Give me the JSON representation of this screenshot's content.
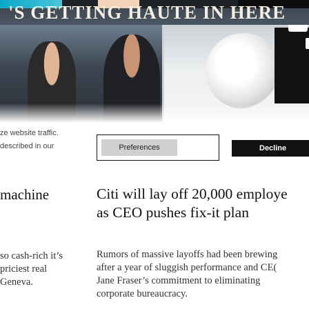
{
  "hero": {
    "headline": "'S GETTING HAUTE IN HERE"
  },
  "cookie_banner": {
    "text_line1": "ze website traffic.",
    "text_line2": "described in our",
    "preferences_label": "Preferences",
    "decline_label": "Decline"
  },
  "articles": {
    "left": {
      "title": "machine",
      "summary_lines": [
        "so cash-rich it’s",
        "priciest real",
        "Geneva."
      ]
    },
    "right": {
      "title_lines": [
        "Citi will lay off 20,000 employe",
        "as CEO pushes fix-it plan"
      ],
      "summary_lines": [
        "Rumors of massive layoffs had been brewing",
        "after a year of sluggish performance and CE(",
        "Jane Fraser’s commitment to eliminating",
        "corporate bureaucracy."
      ]
    }
  }
}
